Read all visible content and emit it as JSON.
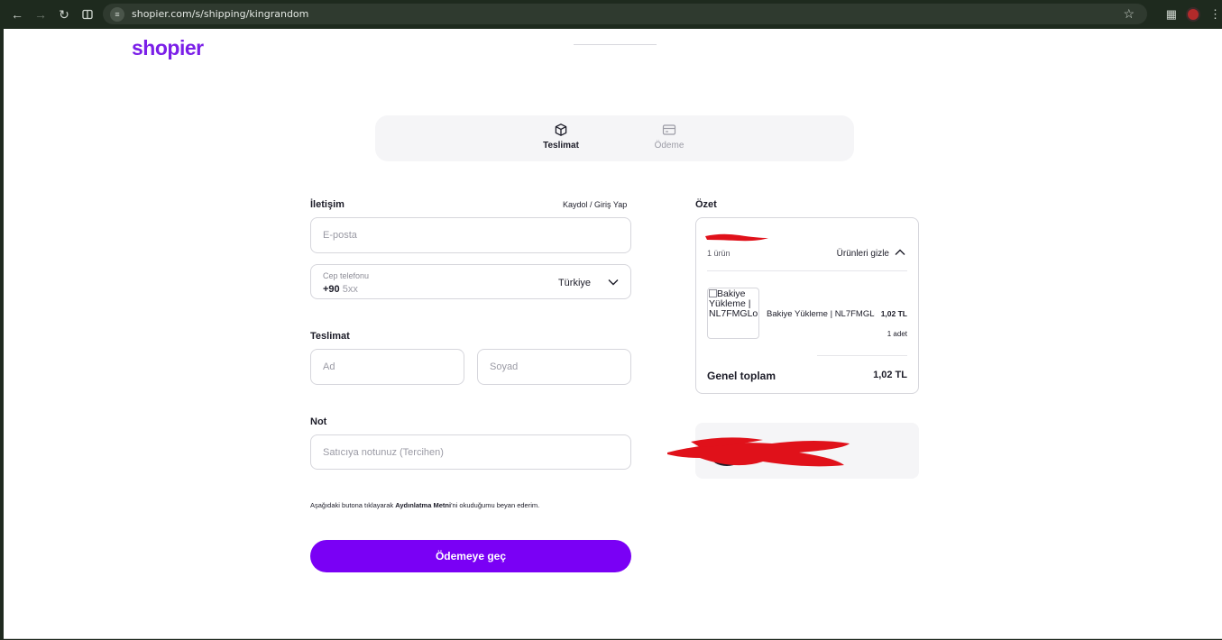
{
  "browser": {
    "url": "shopier.com/s/shipping/kingrandom"
  },
  "brand": {
    "logo_text": "shopier",
    "accent_color": "#7a00f5"
  },
  "steps": [
    {
      "label": "Teslimat",
      "icon": "package-icon",
      "active": true
    },
    {
      "label": "Ödeme",
      "icon": "credit-card-icon",
      "active": false
    }
  ],
  "contact": {
    "heading": "İletişim",
    "login_link": "Kaydol / Giriş Yap",
    "email_placeholder": "E-posta",
    "phone_caption": "Cep telefonu",
    "phone_code": "+90",
    "phone_placeholder": "5xx",
    "country": "Türkiye"
  },
  "shipping": {
    "heading": "Teslimat",
    "first_name_placeholder": "Ad",
    "last_name_placeholder": "Soyad"
  },
  "note": {
    "heading": "Not",
    "placeholder": "Satıcıya notunuz (Tercihen)"
  },
  "disclaimer": {
    "prefix": "Aşağıdaki butona tıklayarak",
    "link": "Aydınlatma Metni",
    "suffix": "'ni okuduğumu beyan ederim."
  },
  "cta_label": "Ödemeye geç",
  "summary": {
    "heading": "Özet",
    "item_count": "1 ürün",
    "hide_items": "Ürünleri gizle",
    "product_image_alt": "Bakiye Yükleme | NL7FMGLo",
    "product_name": "Bakiye Yükleme | NL7FMGLo",
    "product_price": "1,02 TL",
    "product_qty": "1 adet",
    "total_label": "Genel toplam",
    "total_value": "1,02 TL"
  }
}
